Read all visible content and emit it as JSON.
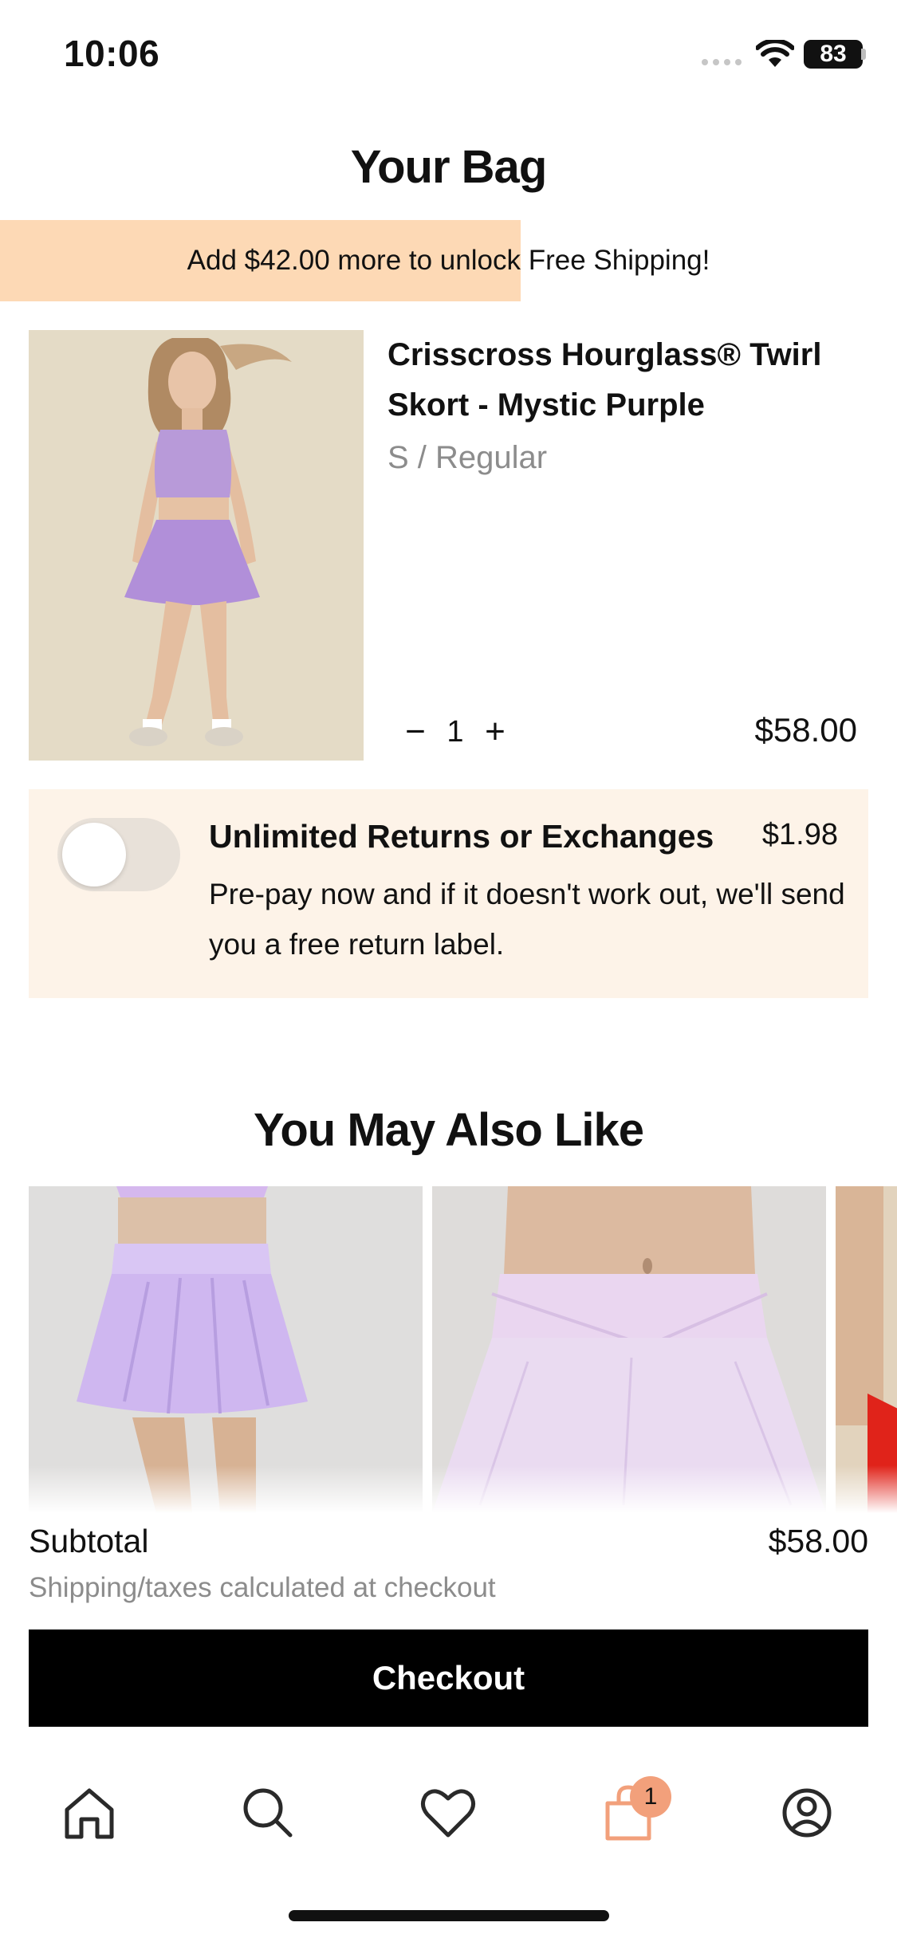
{
  "status_bar": {
    "time": "10:06",
    "battery": "83"
  },
  "header": {
    "title": "Your Bag"
  },
  "shipping_banner": {
    "text": "Add $42.00 more to unlock Free Shipping!",
    "progress_fraction": 0.58,
    "progress_color": "#fdd9b5"
  },
  "cart_item": {
    "name": "Crisscross Hourglass® Twirl Skort - Mystic Purple",
    "variant": "S / Regular",
    "quantity": "1",
    "decrement_symbol": "−",
    "increment_symbol": "+",
    "price": "$58.00"
  },
  "returns": {
    "title": "Unlimited Returns or Exchanges",
    "price": "$1.98",
    "description": "Pre-pay now and if it doesn't work out, we'll send you a free return label.",
    "toggle_on": false
  },
  "recommendations": {
    "title": "You May Also Like",
    "items": [
      {
        "image": "lavender-pleated-skort"
      },
      {
        "image": "lilac-crossover-skort"
      },
      {
        "image": "red-skirt"
      }
    ]
  },
  "totals": {
    "subtotal_label": "Subtotal",
    "subtotal_value": "$58.00",
    "shipping_note": "Shipping/taxes calculated at checkout"
  },
  "checkout": {
    "label": "Checkout"
  },
  "tab_bar": {
    "items": [
      {
        "icon": "home-icon"
      },
      {
        "icon": "search-icon"
      },
      {
        "icon": "heart-icon"
      },
      {
        "icon": "bag-icon",
        "active": true
      },
      {
        "icon": "account-icon"
      }
    ],
    "cart_count": "1",
    "active_color": "#f2a07b"
  }
}
